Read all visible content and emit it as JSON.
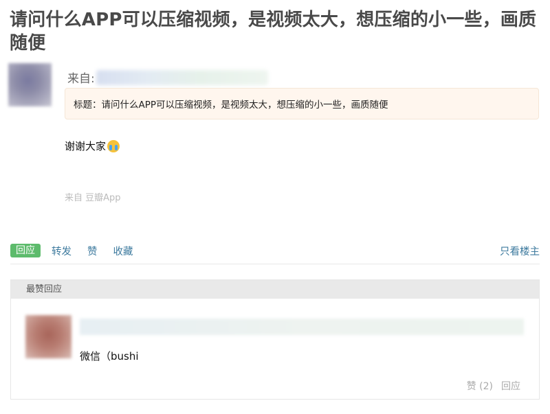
{
  "post": {
    "title": "请问什么APP可以压缩视频，是视频太大，想压缩的小一些，画质随便",
    "from_label": "来自:",
    "quote": "标题：请问什么APP可以压缩视频，是视频太大，想压缩的小一些，画质随便",
    "body": "谢谢大家",
    "emoji": "crying-face-emoji",
    "via": "来自 豆瓣App"
  },
  "actions": {
    "reply": "回应",
    "forward": "转发",
    "like": "赞",
    "collect": "收藏",
    "only_op": "只看楼主"
  },
  "best_replies": {
    "header": "最赞回应",
    "items": [
      {
        "text": "微信（bushi",
        "likes": "赞 (2)",
        "reply": "回应"
      }
    ]
  },
  "colors": {
    "reply_button_bg": "#5dbb6c",
    "link": "#3d7a9e",
    "quote_bg": "#fff6ee",
    "header_bg": "#e9e9e9"
  }
}
